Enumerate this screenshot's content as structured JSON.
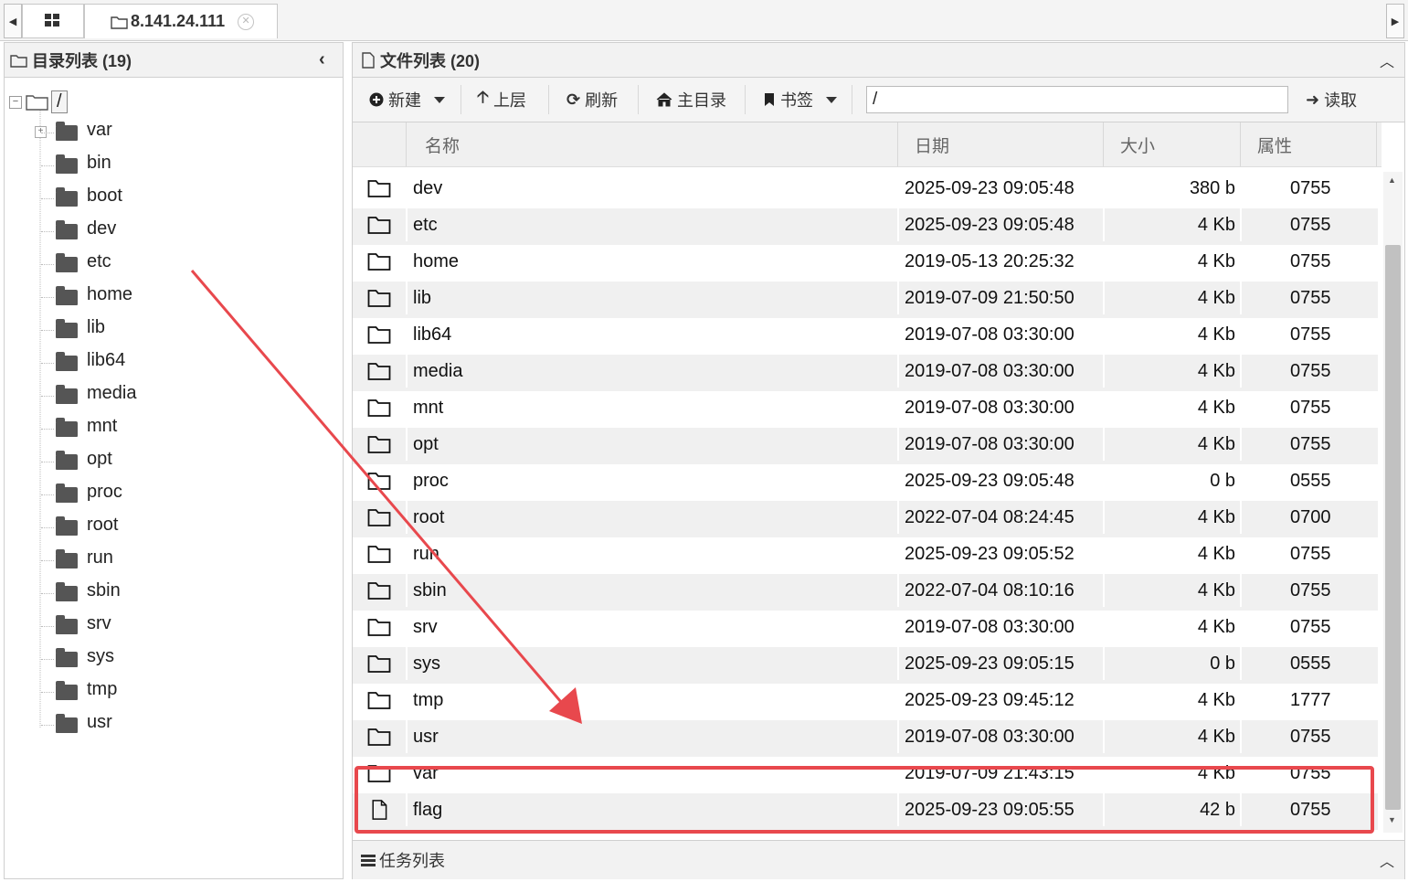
{
  "tabs": {
    "host": "8.141.24.111"
  },
  "left_panel": {
    "title": "目录列表 (19)",
    "root": "/",
    "folders": [
      "var",
      "bin",
      "boot",
      "dev",
      "etc",
      "home",
      "lib",
      "lib64",
      "media",
      "mnt",
      "opt",
      "proc",
      "root",
      "run",
      "sbin",
      "srv",
      "sys",
      "tmp",
      "usr"
    ]
  },
  "right_panel": {
    "title": "文件列表 (20)",
    "toolbar": {
      "new_label": "新建",
      "up_label": "上层",
      "refresh_label": "刷新",
      "home_label": "主目录",
      "bookmark_label": "书签",
      "path_value": "/",
      "read_label": "读取"
    },
    "columns": {
      "name": "名称",
      "date": "日期",
      "size": "大小",
      "attr": "属性"
    },
    "files": [
      {
        "name": "dev",
        "date": "2025-09-23 09:05:48",
        "size": "380 b",
        "attr": "0755",
        "type": "folder"
      },
      {
        "name": "etc",
        "date": "2025-09-23 09:05:48",
        "size": "4 Kb",
        "attr": "0755",
        "type": "folder"
      },
      {
        "name": "home",
        "date": "2019-05-13 20:25:32",
        "size": "4 Kb",
        "attr": "0755",
        "type": "folder"
      },
      {
        "name": "lib",
        "date": "2019-07-09 21:50:50",
        "size": "4 Kb",
        "attr": "0755",
        "type": "folder"
      },
      {
        "name": "lib64",
        "date": "2019-07-08 03:30:00",
        "size": "4 Kb",
        "attr": "0755",
        "type": "folder"
      },
      {
        "name": "media",
        "date": "2019-07-08 03:30:00",
        "size": "4 Kb",
        "attr": "0755",
        "type": "folder"
      },
      {
        "name": "mnt",
        "date": "2019-07-08 03:30:00",
        "size": "4 Kb",
        "attr": "0755",
        "type": "folder"
      },
      {
        "name": "opt",
        "date": "2019-07-08 03:30:00",
        "size": "4 Kb",
        "attr": "0755",
        "type": "folder"
      },
      {
        "name": "proc",
        "date": "2025-09-23 09:05:48",
        "size": "0 b",
        "attr": "0555",
        "type": "folder"
      },
      {
        "name": "root",
        "date": "2022-07-04 08:24:45",
        "size": "4 Kb",
        "attr": "0700",
        "type": "folder"
      },
      {
        "name": "run",
        "date": "2025-09-23 09:05:52",
        "size": "4 Kb",
        "attr": "0755",
        "type": "folder"
      },
      {
        "name": "sbin",
        "date": "2022-07-04 08:10:16",
        "size": "4 Kb",
        "attr": "0755",
        "type": "folder"
      },
      {
        "name": "srv",
        "date": "2019-07-08 03:30:00",
        "size": "4 Kb",
        "attr": "0755",
        "type": "folder"
      },
      {
        "name": "sys",
        "date": "2025-09-23 09:05:15",
        "size": "0 b",
        "attr": "0555",
        "type": "folder"
      },
      {
        "name": "tmp",
        "date": "2025-09-23 09:45:12",
        "size": "4 Kb",
        "attr": "1777",
        "type": "folder"
      },
      {
        "name": "usr",
        "date": "2019-07-08 03:30:00",
        "size": "4 Kb",
        "attr": "0755",
        "type": "folder"
      },
      {
        "name": "var",
        "date": "2019-07-09 21:43:15",
        "size": "4 Kb",
        "attr": "0755",
        "type": "folder"
      },
      {
        "name": "flag",
        "date": "2025-09-23 09:05:55",
        "size": "42 b",
        "attr": "0755",
        "type": "file"
      }
    ]
  },
  "tasks": {
    "title": "任务列表"
  },
  "annotation": {
    "color": "#e8484d"
  }
}
